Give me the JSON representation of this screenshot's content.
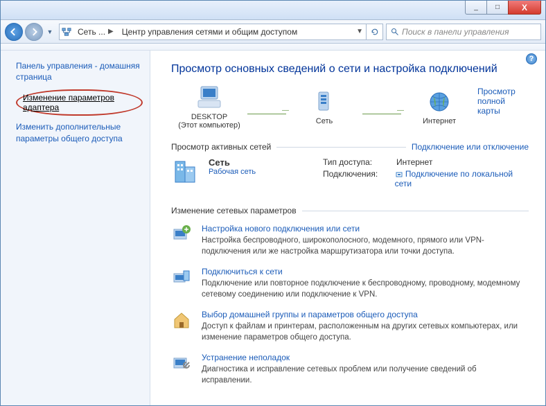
{
  "titlebar": {
    "min": "_",
    "max": "□",
    "close": "X"
  },
  "breadcrumb": {
    "items": [
      "Сеть ...",
      "Центр управления сетями и общим доступом"
    ]
  },
  "search": {
    "placeholder": "Поиск в панели управления"
  },
  "sidebar": {
    "home": "Панель управления - домашняя страница",
    "adapter": "Изменение параметров адаптера",
    "advanced": "Изменить дополнительные параметры общего доступа"
  },
  "main": {
    "heading": "Просмотр основных сведений о сети и настройка подключений",
    "map": {
      "fullmap_link": "Просмотр полной карты",
      "nodes": [
        {
          "label": "DESKTOP",
          "sub": "(Этот компьютер)"
        },
        {
          "label": "Сеть",
          "sub": ""
        },
        {
          "label": "Интернет",
          "sub": ""
        }
      ]
    },
    "active": {
      "title": "Просмотр активных сетей",
      "toggle_link": "Подключение или отключение",
      "net_name": "Сеть",
      "net_type": "Рабочая сеть",
      "access_k": "Тип доступа:",
      "access_v": "Интернет",
      "conn_k": "Подключения:",
      "conn_v": "Подключение по локальной сети"
    },
    "change": {
      "title": "Изменение сетевых параметров",
      "items": [
        {
          "title": "Настройка нового подключения или сети",
          "desc": "Настройка беспроводного, широкополосного, модемного, прямого или VPN-подключения или же настройка маршрутизатора или точки доступа."
        },
        {
          "title": "Подключиться к сети",
          "desc": "Подключение или повторное подключение к беспроводному, проводному, модемному сетевому соединению или подключение к VPN."
        },
        {
          "title": "Выбор домашней группы и параметров общего доступа",
          "desc": "Доступ к файлам и принтерам, расположенным на других сетевых компьютерах, или изменение параметров общего доступа."
        },
        {
          "title": "Устранение неполадок",
          "desc": "Диагностика и исправление сетевых проблем или получение сведений об исправлении."
        }
      ]
    }
  }
}
